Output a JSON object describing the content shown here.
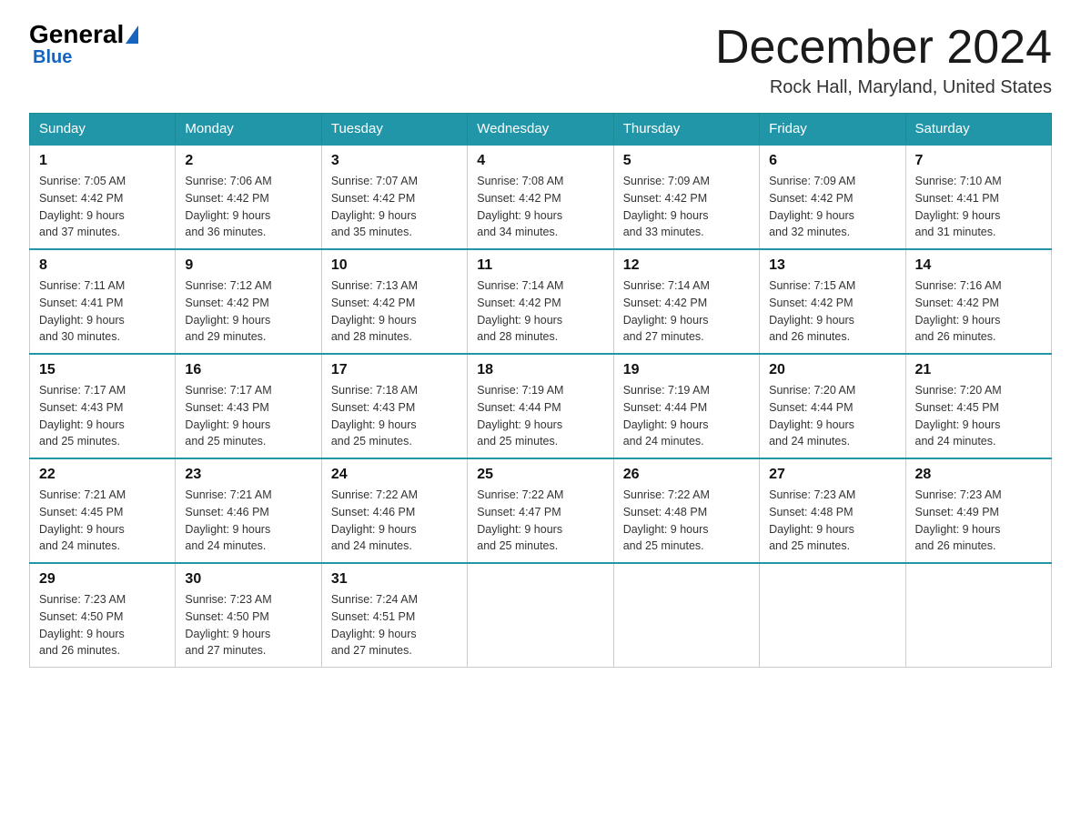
{
  "logo": {
    "general": "General",
    "blue": "Blue"
  },
  "header": {
    "title": "December 2024",
    "subtitle": "Rock Hall, Maryland, United States"
  },
  "days_of_week": [
    "Sunday",
    "Monday",
    "Tuesday",
    "Wednesday",
    "Thursday",
    "Friday",
    "Saturday"
  ],
  "weeks": [
    [
      {
        "day": "1",
        "sunrise": "7:05 AM",
        "sunset": "4:42 PM",
        "daylight": "9 hours and 37 minutes."
      },
      {
        "day": "2",
        "sunrise": "7:06 AM",
        "sunset": "4:42 PM",
        "daylight": "9 hours and 36 minutes."
      },
      {
        "day": "3",
        "sunrise": "7:07 AM",
        "sunset": "4:42 PM",
        "daylight": "9 hours and 35 minutes."
      },
      {
        "day": "4",
        "sunrise": "7:08 AM",
        "sunset": "4:42 PM",
        "daylight": "9 hours and 34 minutes."
      },
      {
        "day": "5",
        "sunrise": "7:09 AM",
        "sunset": "4:42 PM",
        "daylight": "9 hours and 33 minutes."
      },
      {
        "day": "6",
        "sunrise": "7:09 AM",
        "sunset": "4:42 PM",
        "daylight": "9 hours and 32 minutes."
      },
      {
        "day": "7",
        "sunrise": "7:10 AM",
        "sunset": "4:41 PM",
        "daylight": "9 hours and 31 minutes."
      }
    ],
    [
      {
        "day": "8",
        "sunrise": "7:11 AM",
        "sunset": "4:41 PM",
        "daylight": "9 hours and 30 minutes."
      },
      {
        "day": "9",
        "sunrise": "7:12 AM",
        "sunset": "4:42 PM",
        "daylight": "9 hours and 29 minutes."
      },
      {
        "day": "10",
        "sunrise": "7:13 AM",
        "sunset": "4:42 PM",
        "daylight": "9 hours and 28 minutes."
      },
      {
        "day": "11",
        "sunrise": "7:14 AM",
        "sunset": "4:42 PM",
        "daylight": "9 hours and 28 minutes."
      },
      {
        "day": "12",
        "sunrise": "7:14 AM",
        "sunset": "4:42 PM",
        "daylight": "9 hours and 27 minutes."
      },
      {
        "day": "13",
        "sunrise": "7:15 AM",
        "sunset": "4:42 PM",
        "daylight": "9 hours and 26 minutes."
      },
      {
        "day": "14",
        "sunrise": "7:16 AM",
        "sunset": "4:42 PM",
        "daylight": "9 hours and 26 minutes."
      }
    ],
    [
      {
        "day": "15",
        "sunrise": "7:17 AM",
        "sunset": "4:43 PM",
        "daylight": "9 hours and 25 minutes."
      },
      {
        "day": "16",
        "sunrise": "7:17 AM",
        "sunset": "4:43 PM",
        "daylight": "9 hours and 25 minutes."
      },
      {
        "day": "17",
        "sunrise": "7:18 AM",
        "sunset": "4:43 PM",
        "daylight": "9 hours and 25 minutes."
      },
      {
        "day": "18",
        "sunrise": "7:19 AM",
        "sunset": "4:44 PM",
        "daylight": "9 hours and 25 minutes."
      },
      {
        "day": "19",
        "sunrise": "7:19 AM",
        "sunset": "4:44 PM",
        "daylight": "9 hours and 24 minutes."
      },
      {
        "day": "20",
        "sunrise": "7:20 AM",
        "sunset": "4:44 PM",
        "daylight": "9 hours and 24 minutes."
      },
      {
        "day": "21",
        "sunrise": "7:20 AM",
        "sunset": "4:45 PM",
        "daylight": "9 hours and 24 minutes."
      }
    ],
    [
      {
        "day": "22",
        "sunrise": "7:21 AM",
        "sunset": "4:45 PM",
        "daylight": "9 hours and 24 minutes."
      },
      {
        "day": "23",
        "sunrise": "7:21 AM",
        "sunset": "4:46 PM",
        "daylight": "9 hours and 24 minutes."
      },
      {
        "day": "24",
        "sunrise": "7:22 AM",
        "sunset": "4:46 PM",
        "daylight": "9 hours and 24 minutes."
      },
      {
        "day": "25",
        "sunrise": "7:22 AM",
        "sunset": "4:47 PM",
        "daylight": "9 hours and 25 minutes."
      },
      {
        "day": "26",
        "sunrise": "7:22 AM",
        "sunset": "4:48 PM",
        "daylight": "9 hours and 25 minutes."
      },
      {
        "day": "27",
        "sunrise": "7:23 AM",
        "sunset": "4:48 PM",
        "daylight": "9 hours and 25 minutes."
      },
      {
        "day": "28",
        "sunrise": "7:23 AM",
        "sunset": "4:49 PM",
        "daylight": "9 hours and 26 minutes."
      }
    ],
    [
      {
        "day": "29",
        "sunrise": "7:23 AM",
        "sunset": "4:50 PM",
        "daylight": "9 hours and 26 minutes."
      },
      {
        "day": "30",
        "sunrise": "7:23 AM",
        "sunset": "4:50 PM",
        "daylight": "9 hours and 27 minutes."
      },
      {
        "day": "31",
        "sunrise": "7:24 AM",
        "sunset": "4:51 PM",
        "daylight": "9 hours and 27 minutes."
      },
      null,
      null,
      null,
      null
    ]
  ],
  "labels": {
    "sunrise_prefix": "Sunrise: ",
    "sunset_prefix": "Sunset: ",
    "daylight_prefix": "Daylight: "
  }
}
